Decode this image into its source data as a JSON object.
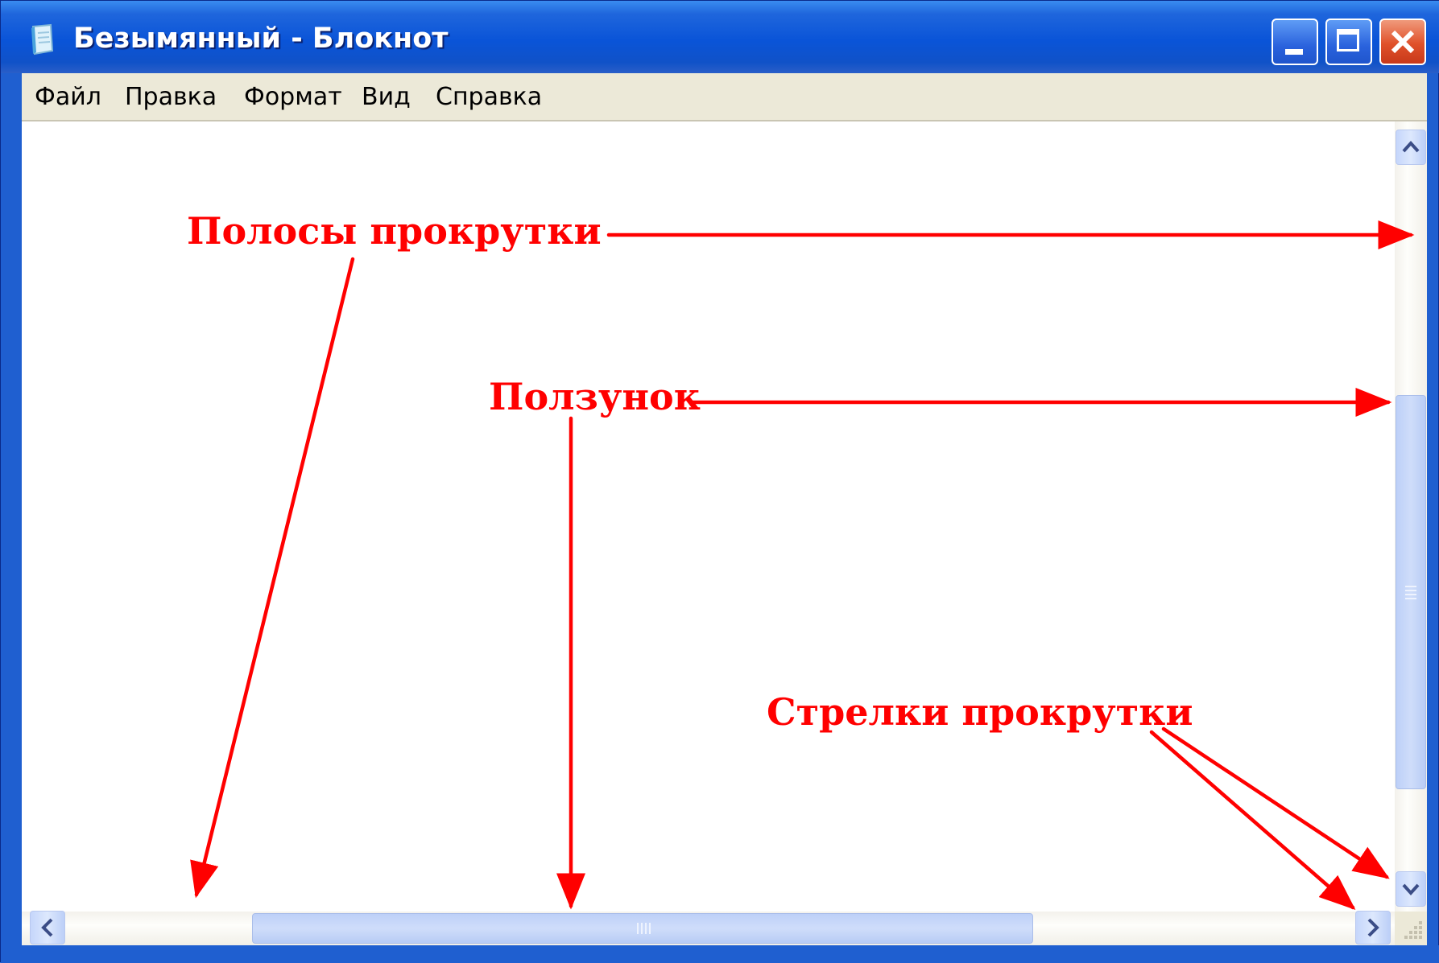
{
  "window": {
    "title": "Безымянный - Блокнот"
  },
  "menu": {
    "file": "Файл",
    "edit": "Правка",
    "format": "Формат",
    "view": "Вид",
    "help": "Справка"
  },
  "annotations": {
    "scrollbars": "Полосы прокрутки",
    "slider": "Ползунок",
    "scroll_arrows": "Стрелки прокрутки"
  },
  "colors": {
    "titlebar": "#0a54d8",
    "annotation": "#ff0000",
    "menubar": "#ece9d8",
    "scroll_thumb": "#c5d6fb"
  }
}
